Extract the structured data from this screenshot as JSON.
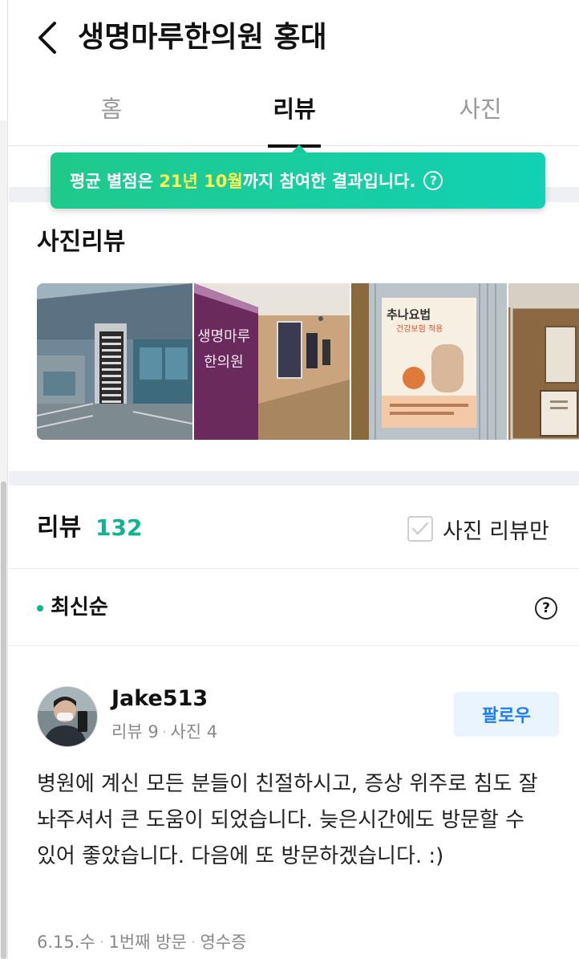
{
  "header": {
    "title": "생명마루한의원 홍대",
    "back_icon": "chevron-left-icon"
  },
  "tabs": [
    {
      "label": "홈",
      "active": false
    },
    {
      "label": "리뷰",
      "active": true
    },
    {
      "label": "사진",
      "active": false
    }
  ],
  "tooltip": {
    "prefix": "평균 별점은 ",
    "year": "21년",
    "month": "10월",
    "suffix": "까지 참여한 결과입니다.",
    "help_icon": "question-circle-icon",
    "colors": {
      "start": "#1fc98b",
      "end": "#12d1b4",
      "highlight": "#fff34f"
    }
  },
  "photo_reviews": {
    "title": "사진리뷰",
    "photos": [
      {
        "alt": "building-exterior-photo"
      },
      {
        "alt": "clinic-entrance-sign-photo",
        "sign_line1": "생명마루",
        "sign_line2": "한의원"
      },
      {
        "alt": "chuna-poster-photo",
        "poster_title": "추나요법",
        "poster_sub": "건강보험 적용"
      },
      {
        "alt": "interior-frames-photo"
      }
    ]
  },
  "reviews": {
    "title": "리뷰",
    "count": "132",
    "photo_only_label": "사진 리뷰만",
    "sort_label": "최신순",
    "accent_color": "#10b58e",
    "items": [
      {
        "username": "Jake513",
        "review_count": "리뷰 9",
        "photo_count": "사진 4",
        "follow_label": "팔로우",
        "text": "병원에 계신 모든 분들이 친절하시고, 증상 위주로 침도 잘 놔주셔서 큰 도움이 되었습니다. 늦은시간에도 방문할 수 있어 좋았습니다. 다음에 또 방문하겠습니다. :)",
        "date": "6.15.수",
        "visit": "1번째 방문",
        "receipt": "영수증"
      }
    ]
  }
}
